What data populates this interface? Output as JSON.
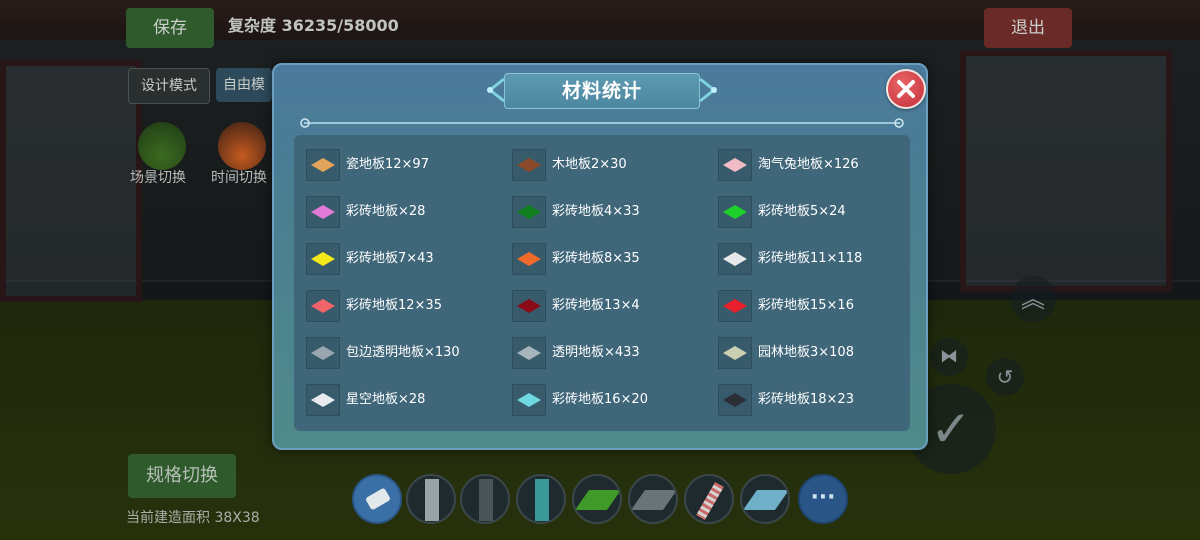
{
  "hud": {
    "save_label": "保存",
    "complexity_text": "复杂度 36235/58000",
    "exit_label": "退出",
    "design_mode_label": "设计模式",
    "free_mode_label": "自由模",
    "scene_switch_label": "场景切换",
    "time_switch_label": "时间切换"
  },
  "bottom": {
    "spec_switch_label": "规格切换",
    "area_label": "当前建造面积 38X38"
  },
  "modal": {
    "title": "材料统计",
    "items": [
      {
        "name": "瓷地板12×97",
        "color": "#e2a35a"
      },
      {
        "name": "木地板2×30",
        "color": "#8a4a2a"
      },
      {
        "name": "淘气兔地板×126",
        "color": "#f2bcc6"
      },
      {
        "name": "彩砖地板×28",
        "color": "#e07ad6"
      },
      {
        "name": "彩砖地板4×33",
        "color": "#13801f"
      },
      {
        "name": "彩砖地板5×24",
        "color": "#1fcf2a"
      },
      {
        "name": "彩砖地板7×43",
        "color": "#f2e81a"
      },
      {
        "name": "彩砖地板8×35",
        "color": "#f06a2a"
      },
      {
        "name": "彩砖地板11×118",
        "color": "#e6e8ea"
      },
      {
        "name": "彩砖地板12×35",
        "color": "#f0646a"
      },
      {
        "name": "彩砖地板13×4",
        "color": "#8a0a18"
      },
      {
        "name": "彩砖地板15×16",
        "color": "#e8202c"
      },
      {
        "name": "包边透明地板×130",
        "color": "#9aa6b0"
      },
      {
        "name": "透明地板×433",
        "color": "#a6b4bc"
      },
      {
        "name": "园林地板3×108",
        "color": "#c9cfb0"
      },
      {
        "name": "星空地板×28",
        "color": "#e8ecee"
      },
      {
        "name": "彩砖地板16×20",
        "color": "#6fd8e0"
      },
      {
        "name": "彩砖地板18×23",
        "color": "#2a2f38"
      }
    ]
  },
  "toolbar": {
    "more_label": "···"
  }
}
